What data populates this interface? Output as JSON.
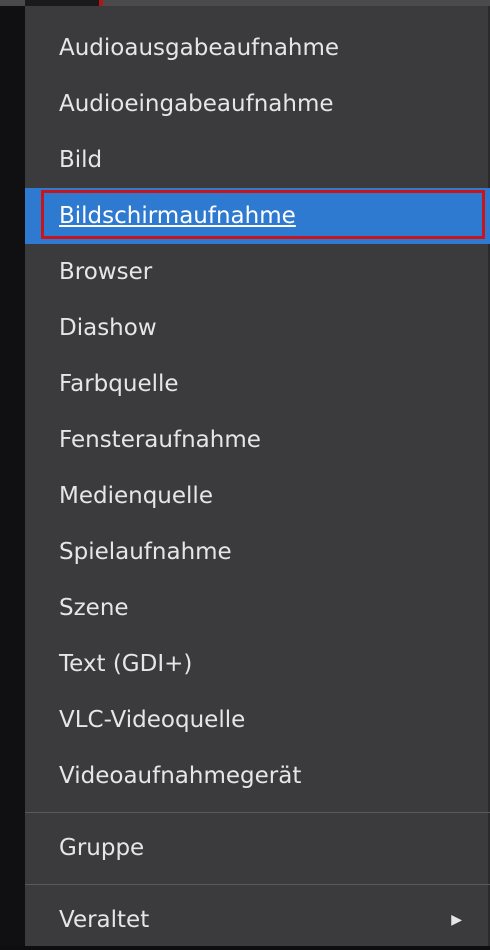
{
  "menu": {
    "items": [
      {
        "label": "Audioausgabeaufnahme"
      },
      {
        "label": "Audioeingabeaufnahme"
      },
      {
        "label": "Bild"
      },
      {
        "label": "Bildschirmaufnahme"
      },
      {
        "label": "Browser"
      },
      {
        "label": "Diashow"
      },
      {
        "label": "Farbquelle"
      },
      {
        "label": "Fensteraufnahme"
      },
      {
        "label": "Medienquelle"
      },
      {
        "label": "Spielaufnahme"
      },
      {
        "label": "Szene"
      },
      {
        "label": "Text (GDI+)"
      },
      {
        "label": "VLC-Videoquelle"
      },
      {
        "label": "Videoaufnahmegerät"
      }
    ],
    "group_item": {
      "label": "Gruppe"
    },
    "deprecated_item": {
      "label": "Veraltet"
    },
    "highlighted_item": "Bildschirmaufnahme",
    "submenu_arrow_icon": "triangle-right-icon"
  },
  "colors": {
    "menu_background": "#3b3b3e",
    "highlight": "#2f7ad1",
    "focus_outline": "#c8141b",
    "text": "#e6e6e6"
  }
}
